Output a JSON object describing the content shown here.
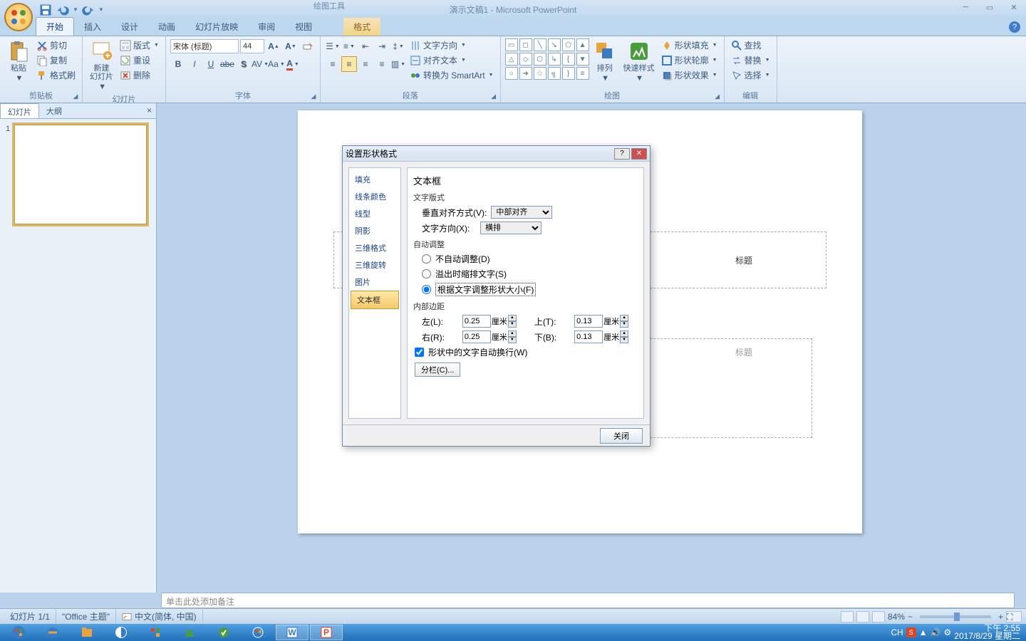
{
  "title_context": "绘图工具",
  "title": "演示文稿1 - Microsoft PowerPoint",
  "qat_tips": [
    "保存",
    "撤销",
    "重做"
  ],
  "tabs": [
    "开始",
    "插入",
    "设计",
    "动画",
    "幻灯片放映",
    "审阅",
    "视图"
  ],
  "ctx_tab": "格式",
  "ribbon": {
    "clipboard": {
      "label": "剪贴板",
      "paste": "粘贴",
      "cut": "剪切",
      "copy": "复制",
      "painter": "格式刷"
    },
    "slides": {
      "label": "幻灯片",
      "new": "新建\n幻灯片",
      "layout": "版式",
      "reset": "重设",
      "delete": "删除"
    },
    "font": {
      "label": "字体",
      "name": "宋体 (标题)",
      "size": "44"
    },
    "para": {
      "label": "段落",
      "dir": "文字方向",
      "align": "对齐文本",
      "smartart": "转换为 SmartArt"
    },
    "draw": {
      "label": "绘图",
      "arrange": "排列",
      "quick": "快速样式",
      "fill": "形状填充",
      "outline": "形状轮廓",
      "effects": "形状效果"
    },
    "edit": {
      "label": "编辑",
      "find": "查找",
      "replace": "替换",
      "select": "选择"
    }
  },
  "thumb_tabs": {
    "slides": "幻灯片",
    "outline": "大纲"
  },
  "slide": {
    "title_ph": "标题",
    "sub_ph": "标题"
  },
  "dialog": {
    "title": "设置形状格式",
    "nav": [
      "填充",
      "线条颜色",
      "线型",
      "阴影",
      "三维格式",
      "三维旋转",
      "图片",
      "文本框"
    ],
    "heading": "文本框",
    "text_layout": "文字版式",
    "valign_label": "垂直对齐方式(V):",
    "valign_value": "中部对齐",
    "dir_label": "文字方向(X):",
    "dir_value": "横排",
    "autofit": "自动调整",
    "opt1": "不自动调整(D)",
    "opt2": "溢出时缩排文字(S)",
    "opt3": "根据文字调整形状大小(F)",
    "margins": "内部边距",
    "left": "左(L):",
    "right": "右(R):",
    "top": "上(T):",
    "bottom": "下(B):",
    "left_v": "0.25",
    "right_v": "0.25",
    "top_v": "0.13",
    "bottom_v": "0.13",
    "unit": "厘米",
    "wrap": "形状中的文字自动换行(W)",
    "columns": "分栏(C)...",
    "close": "关闭"
  },
  "notes": "单击此处添加备注",
  "status": {
    "slide": "幻灯片 1/1",
    "theme": "\"Office 主题\"",
    "lang": "中文(简体, 中国)",
    "zoom": "84%"
  },
  "tray": {
    "ime": "CH",
    "time": "下午 2:55",
    "date": "2017/8/29 星期二"
  }
}
